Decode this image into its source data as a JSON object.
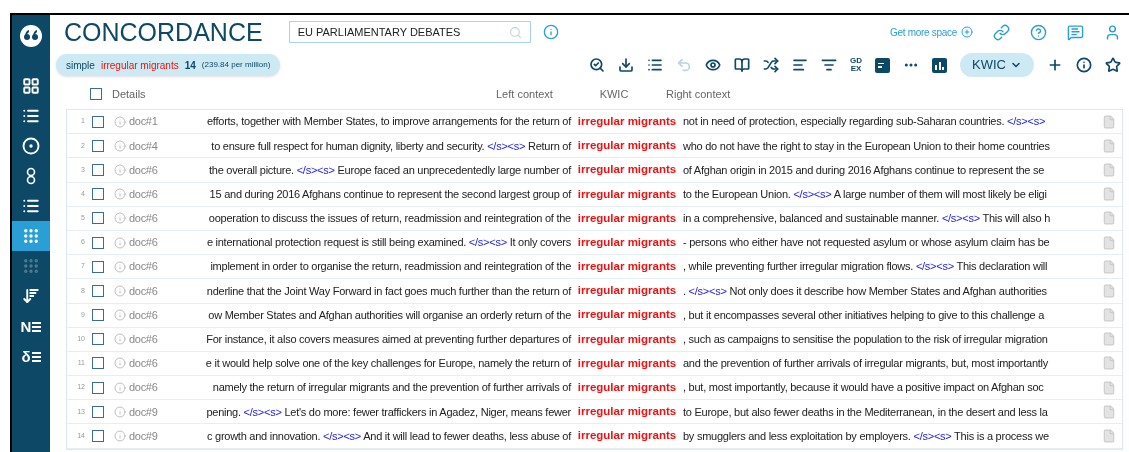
{
  "sidebar": {
    "items": [
      {
        "kind": "logo",
        "selected": false,
        "disabled": false
      },
      {
        "kind": "dashboard",
        "selected": false,
        "disabled": false
      },
      {
        "kind": "list",
        "selected": false,
        "disabled": false
      },
      {
        "kind": "target",
        "selected": false,
        "disabled": false
      },
      {
        "kind": "circles",
        "selected": false,
        "disabled": false
      },
      {
        "kind": "bullets",
        "selected": false,
        "disabled": false
      },
      {
        "kind": "concordance",
        "selected": true,
        "disabled": false
      },
      {
        "kind": "grid",
        "selected": false,
        "disabled": true
      },
      {
        "kind": "sort",
        "selected": false,
        "disabled": false
      },
      {
        "kind": "letter",
        "label": "N",
        "selected": false,
        "disabled": false
      },
      {
        "kind": "letter",
        "label": "δ",
        "selected": false,
        "disabled": false
      }
    ]
  },
  "header": {
    "title": "CONCORDANCE",
    "corpus_field": {
      "value": "EU PARLIAMENTARY DEBATES"
    },
    "get_more_space": "Get more space",
    "top_icons": [
      {
        "kind": "link"
      },
      {
        "kind": "help"
      },
      {
        "kind": "feedback"
      },
      {
        "kind": "user"
      }
    ]
  },
  "query": {
    "type": "simple",
    "term": "irregular migrants",
    "count": "14",
    "frequency": "(239.84 per million)"
  },
  "toolbar": [
    {
      "kind": "search-refresh",
      "disabled": false
    },
    {
      "kind": "download",
      "disabled": false
    },
    {
      "kind": "list",
      "disabled": false
    },
    {
      "kind": "undo",
      "disabled": true
    },
    {
      "kind": "eye",
      "disabled": false
    },
    {
      "kind": "book",
      "disabled": false
    },
    {
      "kind": "shuffle",
      "disabled": false
    },
    {
      "kind": "sort",
      "disabled": false
    },
    {
      "kind": "filter",
      "disabled": false
    },
    {
      "kind": "text",
      "lines": [
        "GD",
        "EX"
      ],
      "disabled": false
    },
    {
      "kind": "panel",
      "disabled": false
    },
    {
      "kind": "dots",
      "disabled": false
    },
    {
      "kind": "chart",
      "disabled": false
    },
    {
      "kind": "dropdown",
      "label": "KWIC",
      "disabled": false
    },
    {
      "kind": "plus",
      "disabled": false
    },
    {
      "kind": "info",
      "disabled": false
    },
    {
      "kind": "star",
      "disabled": false
    }
  ],
  "table": {
    "columns": [
      "Details",
      "Left context",
      "KWIC",
      "Right context"
    ],
    "all_checked": false,
    "rows": [
      {
        "num": "1",
        "checked": false,
        "doc": "doc#1",
        "left": [
          {
            "kind": "text",
            "text": "efforts, together with Member States, to improve arrangements for the return of"
          }
        ],
        "kwic": "irregular migrants",
        "right": [
          {
            "kind": "text",
            "text": "not in need of protection, especially regarding sub-Saharan countries."
          },
          {
            "kind": "tag",
            "text": "</s><s>"
          }
        ]
      },
      {
        "num": "2",
        "checked": false,
        "doc": "doc#4",
        "left": [
          {
            "kind": "text",
            "text": "to ensure full respect for human dignity, liberty and security."
          },
          {
            "kind": "tag",
            "text": "</s><s>"
          },
          {
            "kind": "text",
            "text": "Return of"
          }
        ],
        "kwic": "irregular migrants",
        "right": [
          {
            "kind": "text",
            "text": "who do not have the right to stay in the European Union to their home countries"
          }
        ]
      },
      {
        "num": "3",
        "checked": false,
        "doc": "doc#6",
        "left": [
          {
            "kind": "text",
            "text": "the overall picture."
          },
          {
            "kind": "tag",
            "text": "</s><s>"
          },
          {
            "kind": "text",
            "text": "Europe faced an unprecedentedly large number of"
          }
        ],
        "kwic": "irregular migrants",
        "right": [
          {
            "kind": "text",
            "text": "of Afghan origin in 2015 and during 2016 Afghans continue to represent the se"
          }
        ]
      },
      {
        "num": "4",
        "checked": false,
        "doc": "doc#6",
        "left": [
          {
            "kind": "text",
            "text": "15 and during 2016 Afghans continue to represent the second largest group of"
          }
        ],
        "kwic": "irregular migrants",
        "right": [
          {
            "kind": "text",
            "text": "to the European Union."
          },
          {
            "kind": "tag",
            "text": "</s><s>"
          },
          {
            "kind": "text",
            "text": "A large number of them will most likely be eligi"
          }
        ]
      },
      {
        "num": "5",
        "checked": false,
        "doc": "doc#6",
        "left": [
          {
            "kind": "text",
            "text": "ooperation to discuss the issues of return, readmission and reintegration of the"
          }
        ],
        "kwic": "irregular migrants",
        "right": [
          {
            "kind": "text",
            "text": "in a comprehensive, balanced and sustainable manner."
          },
          {
            "kind": "tag",
            "text": "</s><s>"
          },
          {
            "kind": "text",
            "text": "This will also h"
          }
        ]
      },
      {
        "num": "6",
        "checked": false,
        "doc": "doc#6",
        "left": [
          {
            "kind": "text",
            "text": "e international protection request is still being examined."
          },
          {
            "kind": "tag",
            "text": "</s><s>"
          },
          {
            "kind": "text",
            "text": "It only covers"
          }
        ],
        "kwic": "irregular migrants",
        "right": [
          {
            "kind": "text",
            "text": "- persons who either have not requested asylum or whose asylum claim has be"
          }
        ]
      },
      {
        "num": "7",
        "checked": false,
        "doc": "doc#6",
        "left": [
          {
            "kind": "text",
            "text": "implement in order to organise the return, readmission and reintegration of the"
          }
        ],
        "kwic": "irregular migrants",
        "right": [
          {
            "kind": "text",
            "text": ", while preventing further irregular migration flows."
          },
          {
            "kind": "tag",
            "text": "</s><s>"
          },
          {
            "kind": "text",
            "text": "This declaration will"
          }
        ]
      },
      {
        "num": "8",
        "checked": false,
        "doc": "doc#6",
        "left": [
          {
            "kind": "text",
            "text": "nderline that the Joint Way Forward in fact goes much further than the return of"
          }
        ],
        "kwic": "irregular migrants",
        "right": [
          {
            "kind": "text",
            "text": "."
          },
          {
            "kind": "tag",
            "text": "</s><s>"
          },
          {
            "kind": "text",
            "text": "Not only does it describe how Member States and Afghan authorities"
          }
        ]
      },
      {
        "num": "9",
        "checked": false,
        "doc": "doc#6",
        "left": [
          {
            "kind": "text",
            "text": "ow Member States and Afghan authorities will organise an orderly return of the"
          }
        ],
        "kwic": "irregular migrants",
        "right": [
          {
            "kind": "text",
            "text": ", but it encompasses several other initiatives helping to give to this challenge a"
          }
        ]
      },
      {
        "num": "10",
        "checked": false,
        "doc": "doc#6",
        "left": [
          {
            "kind": "text",
            "text": "For instance, it also covers measures aimed at preventing further departures of"
          }
        ],
        "kwic": "irregular migrants",
        "right": [
          {
            "kind": "text",
            "text": ", such as campaigns to sensitise the population to the risk of irregular migration"
          }
        ]
      },
      {
        "num": "11",
        "checked": false,
        "doc": "doc#6",
        "left": [
          {
            "kind": "text",
            "text": "e it would help solve one of the key challenges for Europe, namely the return of"
          }
        ],
        "kwic": "irregular migrants",
        "right": [
          {
            "kind": "text",
            "text": "and the prevention of further arrivals of irregular migrants, but, most importantly"
          }
        ]
      },
      {
        "num": "12",
        "checked": false,
        "doc": "doc#6",
        "left": [
          {
            "kind": "text",
            "text": "namely the return of irregular migrants and the prevention of further arrivals of"
          }
        ],
        "kwic": "irregular migrants",
        "right": [
          {
            "kind": "text",
            "text": ", but, most importantly, because it would have a positive impact on Afghan soc"
          }
        ]
      },
      {
        "num": "13",
        "checked": false,
        "doc": "doc#9",
        "left": [
          {
            "kind": "text",
            "text": "pening."
          },
          {
            "kind": "tag",
            "text": "</s><s>"
          },
          {
            "kind": "text",
            "text": "Let's do more: fewer traffickers in Agadez, Niger, means fewer"
          }
        ],
        "kwic": "irregular migrants",
        "right": [
          {
            "kind": "text",
            "text": "to Europe, but also fewer deaths in the Mediterranean, in the desert and less la"
          }
        ]
      },
      {
        "num": "14",
        "checked": false,
        "doc": "doc#9",
        "left": [
          {
            "kind": "text",
            "text": "c growth and innovation."
          },
          {
            "kind": "tag",
            "text": "</s><s>"
          },
          {
            "kind": "text",
            "text": "And it will lead to fewer deaths, less abuse of"
          }
        ],
        "kwic": "irregular migrants",
        "right": [
          {
            "kind": "text",
            "text": "by smugglers and less exploitation by employers."
          },
          {
            "kind": "tag",
            "text": "</s><s>"
          },
          {
            "kind": "text",
            "text": "This is a process we"
          }
        ]
      }
    ]
  }
}
